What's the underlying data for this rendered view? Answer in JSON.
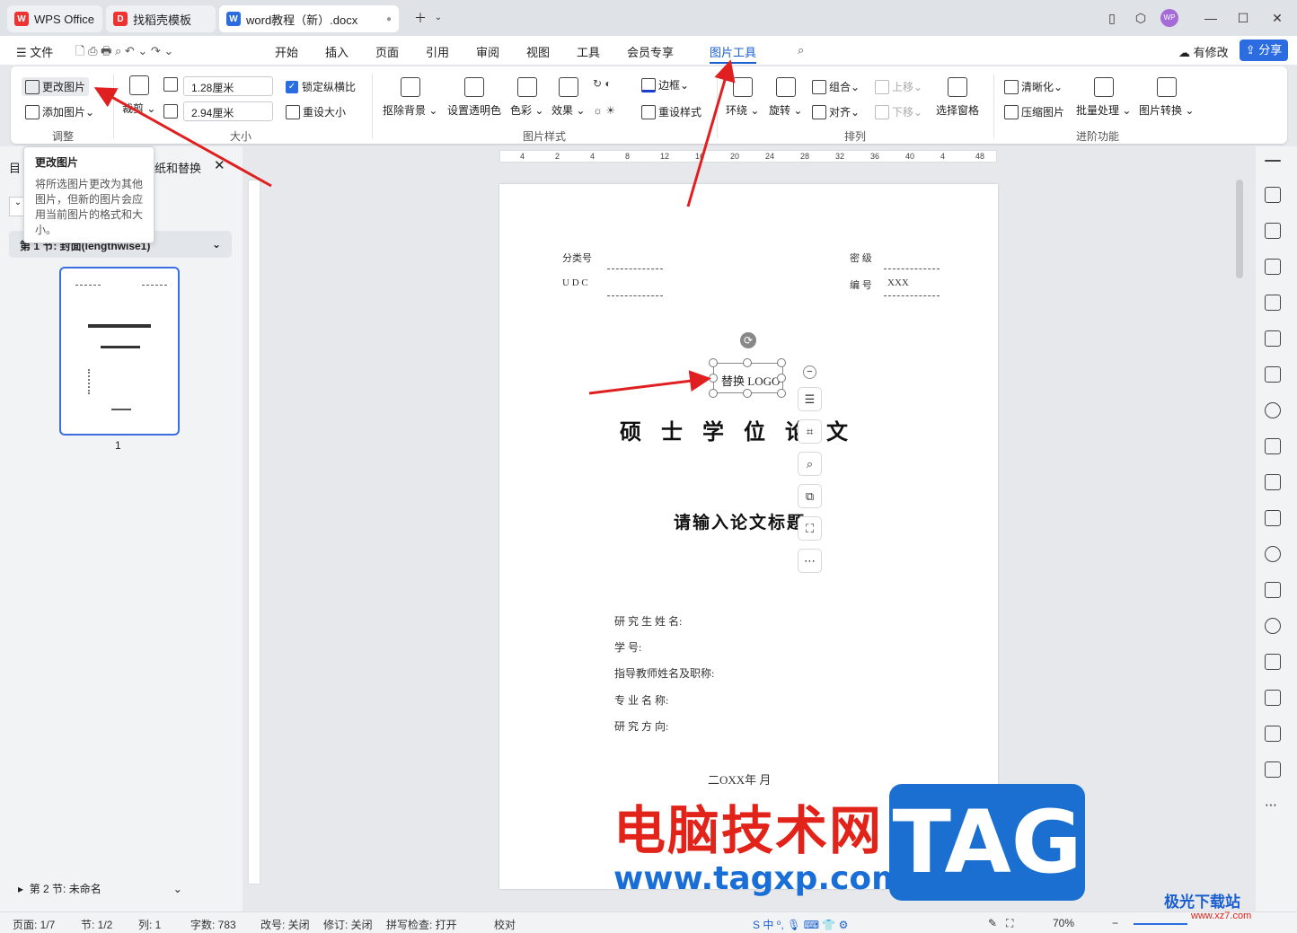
{
  "tabs": [
    {
      "label": "WPS Office"
    },
    {
      "label": "找稻壳模板"
    },
    {
      "label": "word教程（新）.docx"
    }
  ],
  "menu": {
    "file": "文件",
    "items": [
      "开始",
      "插入",
      "页面",
      "引用",
      "审阅",
      "视图",
      "工具",
      "会员专享",
      "图片工具"
    ],
    "active": "图片工具",
    "modified": "有修改",
    "share": "分享"
  },
  "ribbon": {
    "adjust": {
      "change_image": "更改图片",
      "add_image": "添加图片",
      "group": "调整"
    },
    "size": {
      "crop": "裁剪",
      "height": "1.28厘米",
      "width": "2.94厘米",
      "lock_ratio": "锁定纵横比",
      "reset_size": "重设大小",
      "group": "大小"
    },
    "style": {
      "remove_bg": "抠除背景",
      "set_transparent": "设置透明色",
      "color": "色彩",
      "effect": "效果",
      "border": "边框",
      "reset_style": "重设样式",
      "group": "图片样式"
    },
    "arrange": {
      "wrap": "环绕",
      "rotate": "旋转",
      "group_btn": "组合",
      "align": "对齐",
      "up": "上移",
      "down": "下移",
      "select_pane": "选择窗格",
      "group": "排列"
    },
    "advanced": {
      "sharpen": "清晰化",
      "compress": "压缩图片",
      "batch": "批量处理",
      "convert": "图片转换",
      "group": "进阶功能"
    }
  },
  "tooltip": {
    "title": "更改图片",
    "body": "将所选图片更改为其他图片，但新的图片会应用当前图片的格式和大小。"
  },
  "leftpanel": {
    "header": "目",
    "header2": "纸和替换",
    "section1": "第 1 节: 封面(lengthwise1)",
    "page_num": "1",
    "section2": "第 2 节: 未命名"
  },
  "ruler": {
    "h": [
      "4",
      "2",
      "4",
      "8",
      "12",
      "16",
      "20",
      "24",
      "28",
      "32",
      "36",
      "40",
      "4",
      "48"
    ]
  },
  "page": {
    "cls_label": "分类号",
    "udc_label": "U D C",
    "secret_label": "密 级",
    "num_label": "编 号",
    "num_value": "XXX",
    "logo": "替换 LOGO",
    "title": "硕 士 学 位 论 文",
    "subtitle": "请输入论文标题",
    "fields": [
      "研 究 生 姓 名:",
      "学 号:",
      "指导教师姓名及职称:",
      "专 业 名 称:",
      "研 究 方 向:"
    ],
    "date": "二OXX年 月"
  },
  "status": {
    "page": "页面: 1/7",
    "section": "节: 1/2",
    "col": "列: 1",
    "words": "字数: 783",
    "rev": "改号: 关闭",
    "track": "修订: 关闭",
    "spell": "拼写检查: 打开",
    "proof": "校对",
    "zoom": "70%"
  },
  "watermark": {
    "cn": "电脑技术网",
    "url": "www.tagxp.com",
    "tag": "TAG",
    "site2": "极光下载站",
    "site2url": "www.xz7.com"
  }
}
